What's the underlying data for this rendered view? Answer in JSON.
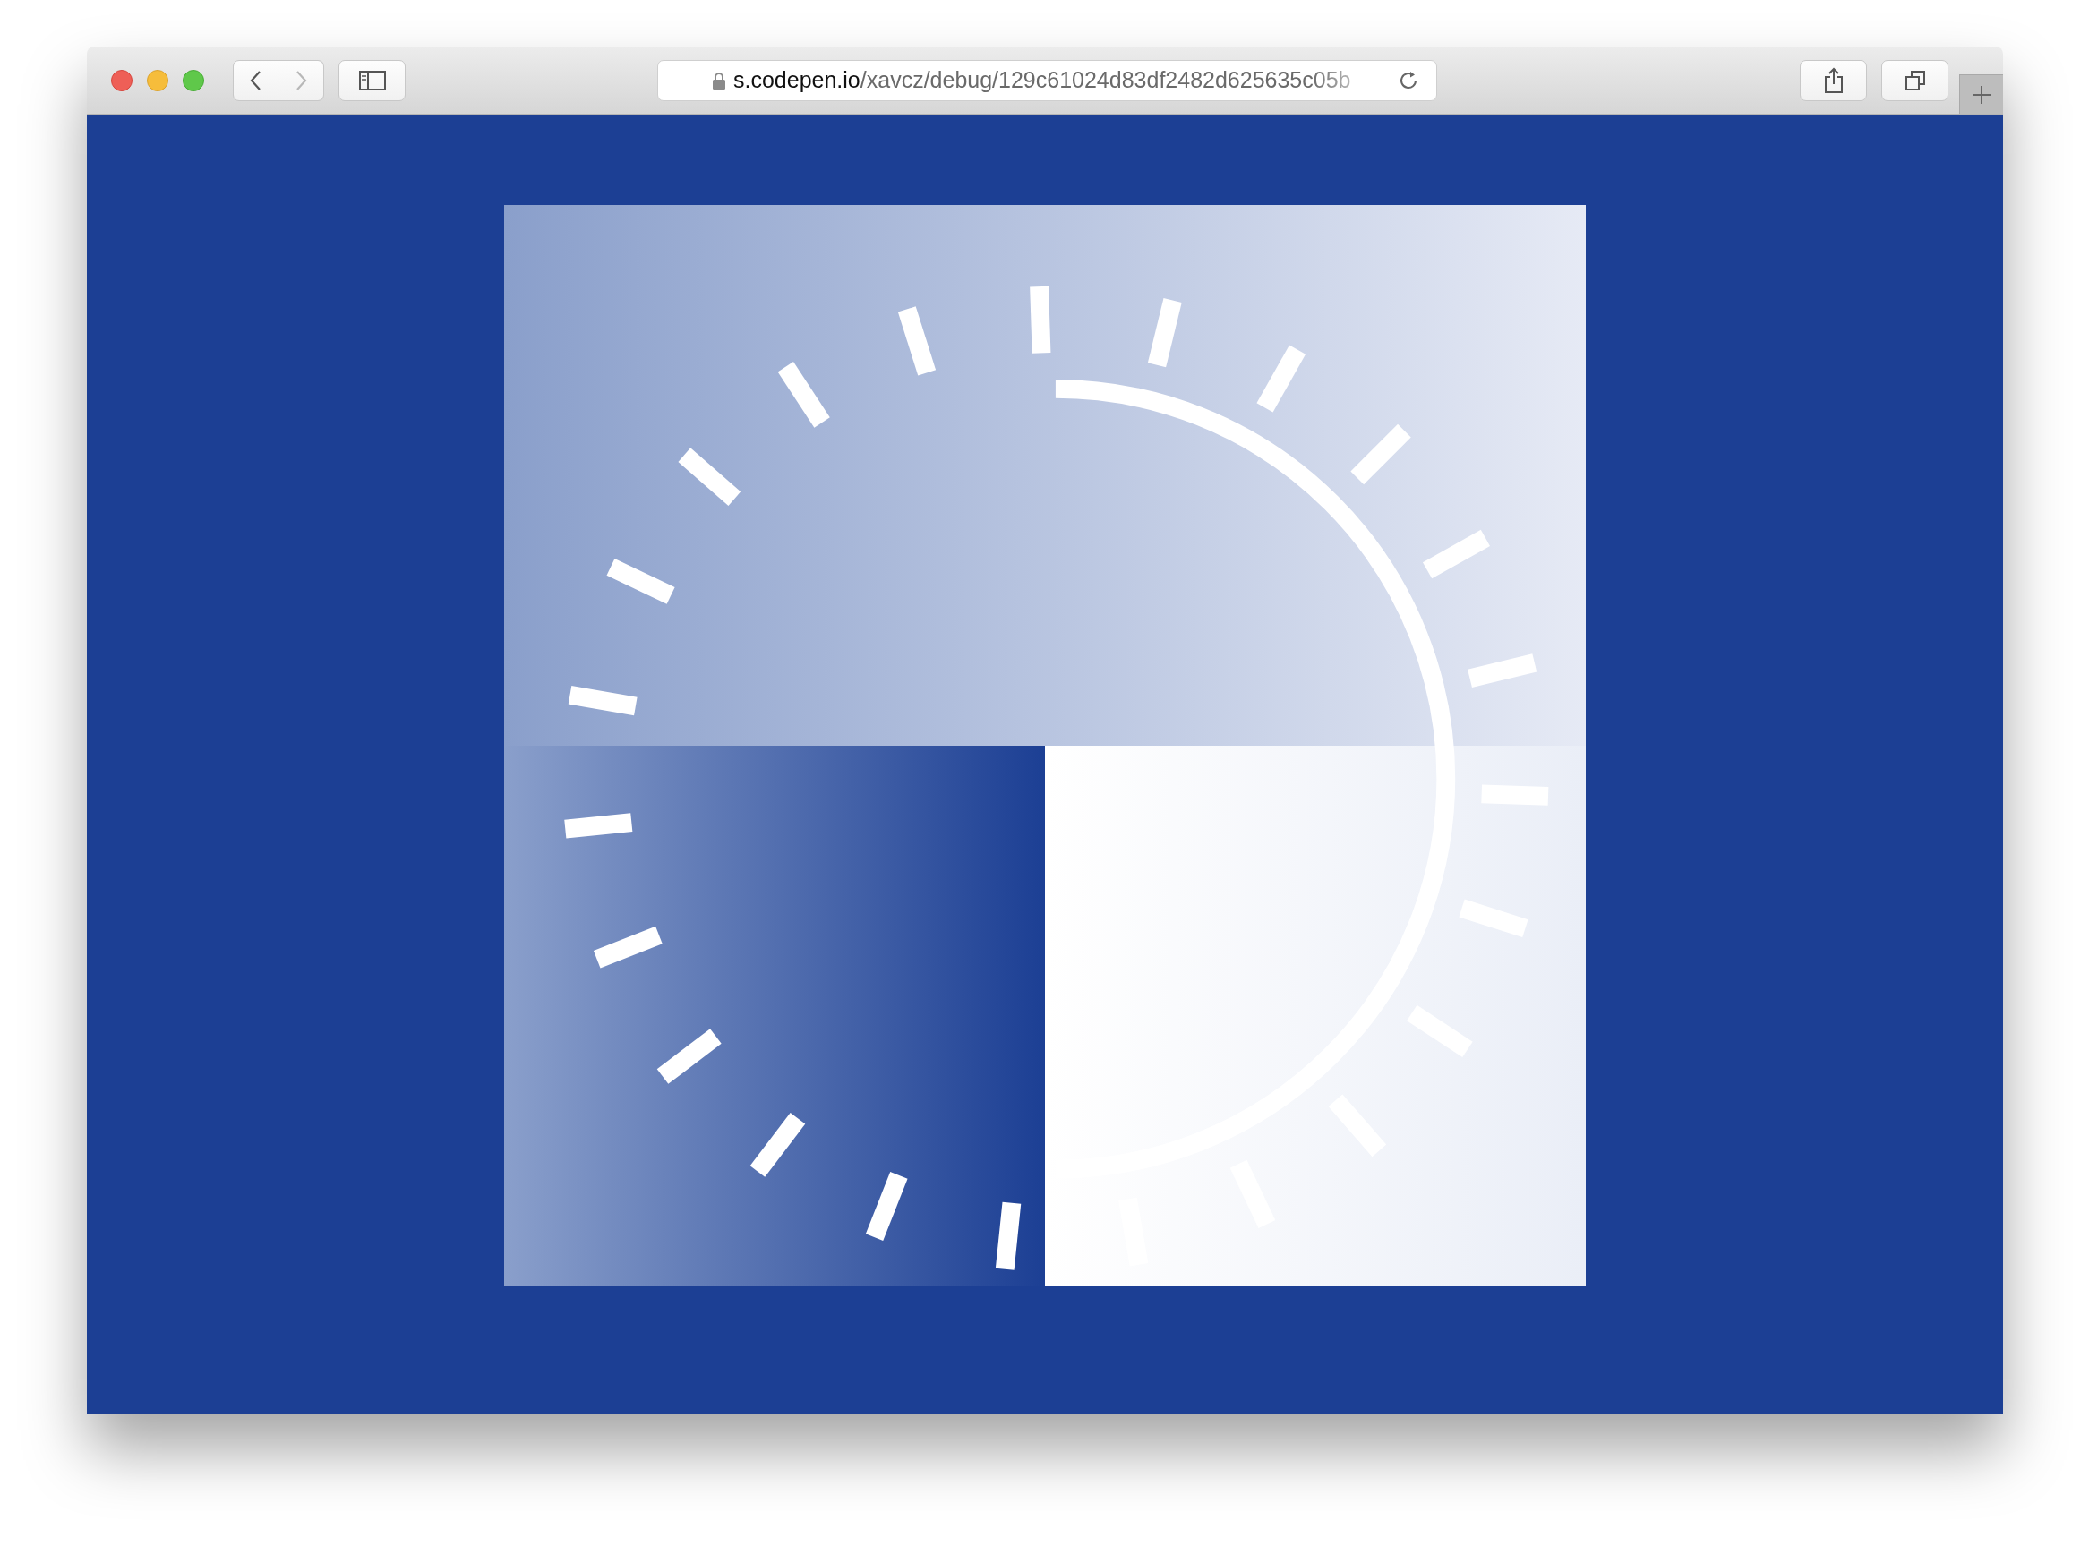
{
  "browser": {
    "nav_buttons": [
      {
        "kind": "back",
        "disabled": false
      },
      {
        "kind": "forward",
        "disabled": true
      }
    ],
    "address_bar": {
      "host": "s.codepen.io",
      "path": "/xavcz/debug/129c61024d83df2482d625635c05b"
    }
  }
}
